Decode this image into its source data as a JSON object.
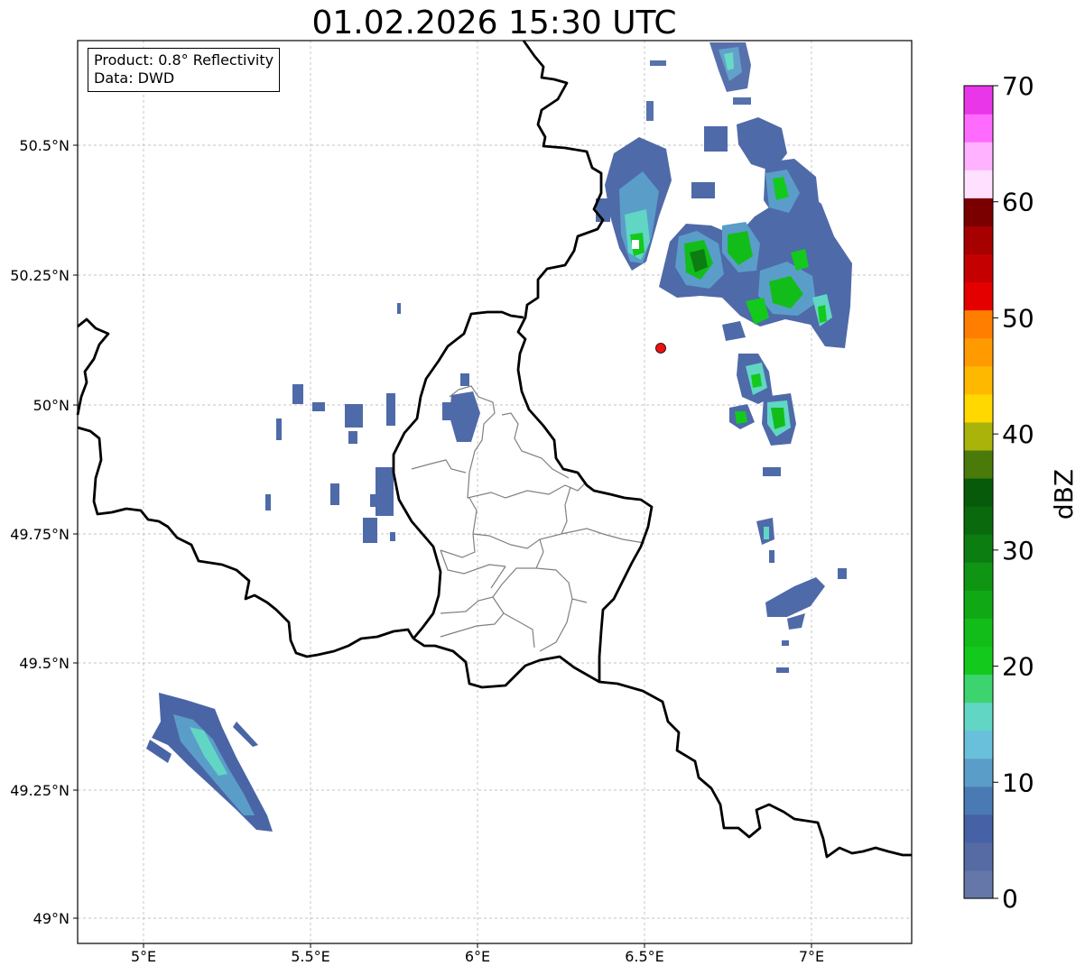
{
  "title": "01.02.2026 15:30 UTC",
  "info": {
    "product": "Product: 0.8° Reflectivity",
    "source": "Data: DWD"
  },
  "axes": {
    "lon_ticks": [
      "5°E",
      "5.5°E",
      "6°E",
      "6.5°E",
      "7°E"
    ],
    "lat_ticks": [
      "50.5°N",
      "50.25°N",
      "50°N",
      "49.75°N",
      "49.5°N",
      "49.25°N",
      "49°N"
    ],
    "grid": true
  },
  "colorbar": {
    "label": "dBZ",
    "min": 0,
    "max": 70,
    "tick_labels": [
      "0",
      "10",
      "20",
      "30",
      "40",
      "50",
      "60",
      "70"
    ],
    "colors": [
      "#6577a8",
      "#566aa3",
      "#4661a6",
      "#4a7ab3",
      "#5b9dc9",
      "#68c0db",
      "#61d6c4",
      "#3dd46f",
      "#12c91c",
      "#12bd1a",
      "#11a816",
      "#109414",
      "#0c7d10",
      "#0a690d",
      "#075a0a",
      "#4a7a0a",
      "#aab30a",
      "#ffd800",
      "#ffb800",
      "#ff9a00",
      "#ff7e00",
      "#e50000",
      "#c40000",
      "#a60000",
      "#7a0000",
      "#ffe0ff",
      "#ffb2ff",
      "#ff6aff",
      "#e836e8"
    ]
  },
  "radar_site": {
    "label": "radar-site",
    "lon": 6.547,
    "lat": 50.111
  },
  "colors": {
    "border": "#000000",
    "districts": "#808080",
    "site": "#ee1111",
    "grid": "#b0b0b0"
  }
}
